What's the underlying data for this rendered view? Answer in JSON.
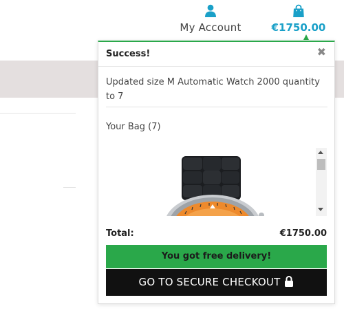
{
  "header": {
    "account_label": "My Account",
    "account_icon": "user-icon",
    "bag_total": "€1750.00",
    "bag_icon": "shopping-bag-icon",
    "accent_color": "#1aa0c8"
  },
  "popup": {
    "title": "Success!",
    "close_icon": "close-icon",
    "message": "Updated size M Automatic Watch 2000 quantity to 7",
    "bag_title": "Your Bag (7)",
    "item_image": "orange-dial-black-strap-watch",
    "total_label": "Total:",
    "total_value": "€1750.00",
    "free_delivery": "You got free delivery!",
    "checkout_label": "GO TO SECURE CHECKOUT",
    "checkout_icon": "lock-icon",
    "success_color": "#2aa84a"
  }
}
